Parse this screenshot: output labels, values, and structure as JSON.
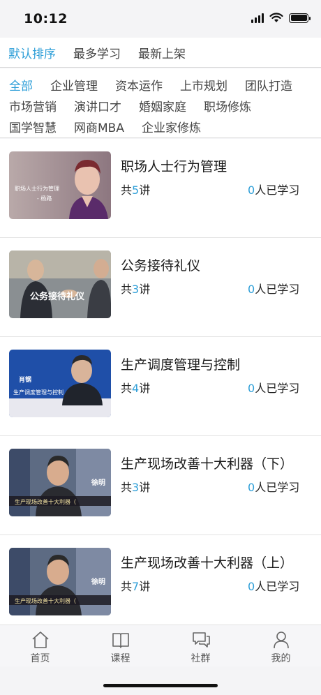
{
  "status_bar": {
    "time": "10:12"
  },
  "sort_tabs": [
    {
      "label": "默认排序",
      "active": true
    },
    {
      "label": "最多学习",
      "active": false
    },
    {
      "label": "最新上架",
      "active": false
    }
  ],
  "categories": [
    [
      {
        "label": "全部",
        "active": true
      },
      {
        "label": "企业管理"
      },
      {
        "label": "资本运作"
      },
      {
        "label": "上市规划"
      },
      {
        "label": "团队打造"
      }
    ],
    [
      {
        "label": "市场营销"
      },
      {
        "label": "演讲口才"
      },
      {
        "label": "婚姻家庭"
      },
      {
        "label": "职场修炼"
      }
    ],
    [
      {
        "label": "国学智慧"
      },
      {
        "label": "网商MBA"
      },
      {
        "label": "企业家修炼"
      }
    ]
  ],
  "courses": [
    {
      "title": "职场人士行为管理",
      "lessons_prefix": "共",
      "lessons": "5",
      "lessons_suffix": "讲",
      "students": "0",
      "students_suffix": "人已学习",
      "thumb_caption": "职场人士行为管理",
      "thumb_caption2": "- 杨路"
    },
    {
      "title": "公务接待礼仪",
      "lessons_prefix": "共",
      "lessons": "3",
      "lessons_suffix": "讲",
      "students": "0",
      "students_suffix": "人已学习",
      "thumb_caption": "公务接待礼仪"
    },
    {
      "title": "生产调度管理与控制",
      "lessons_prefix": "共",
      "lessons": "4",
      "lessons_suffix": "讲",
      "students": "0",
      "students_suffix": "人已学习",
      "thumb_caption": "肖钢",
      "thumb_caption2": "生产调度管理与控制"
    },
    {
      "title": "生产现场改善十大利器（下）",
      "lessons_prefix": "共",
      "lessons": "3",
      "lessons_suffix": "讲",
      "students": "0",
      "students_suffix": "人已学习",
      "thumb_caption": "徐明",
      "thumb_caption2": "生产现场改善十大利器（"
    },
    {
      "title": "生产现场改善十大利器（上）",
      "lessons_prefix": "共",
      "lessons": "7",
      "lessons_suffix": "讲",
      "students": "0",
      "students_suffix": "人已学习",
      "thumb_caption": "徐明",
      "thumb_caption2": "生产现场改善十大利器（"
    }
  ],
  "tab_bar": [
    {
      "label": "首页",
      "icon": "home-icon"
    },
    {
      "label": "课程",
      "icon": "book-icon"
    },
    {
      "label": "社群",
      "icon": "chat-icon"
    },
    {
      "label": "我的",
      "icon": "person-icon"
    }
  ],
  "colors": {
    "accent": "#2f9fd8"
  }
}
